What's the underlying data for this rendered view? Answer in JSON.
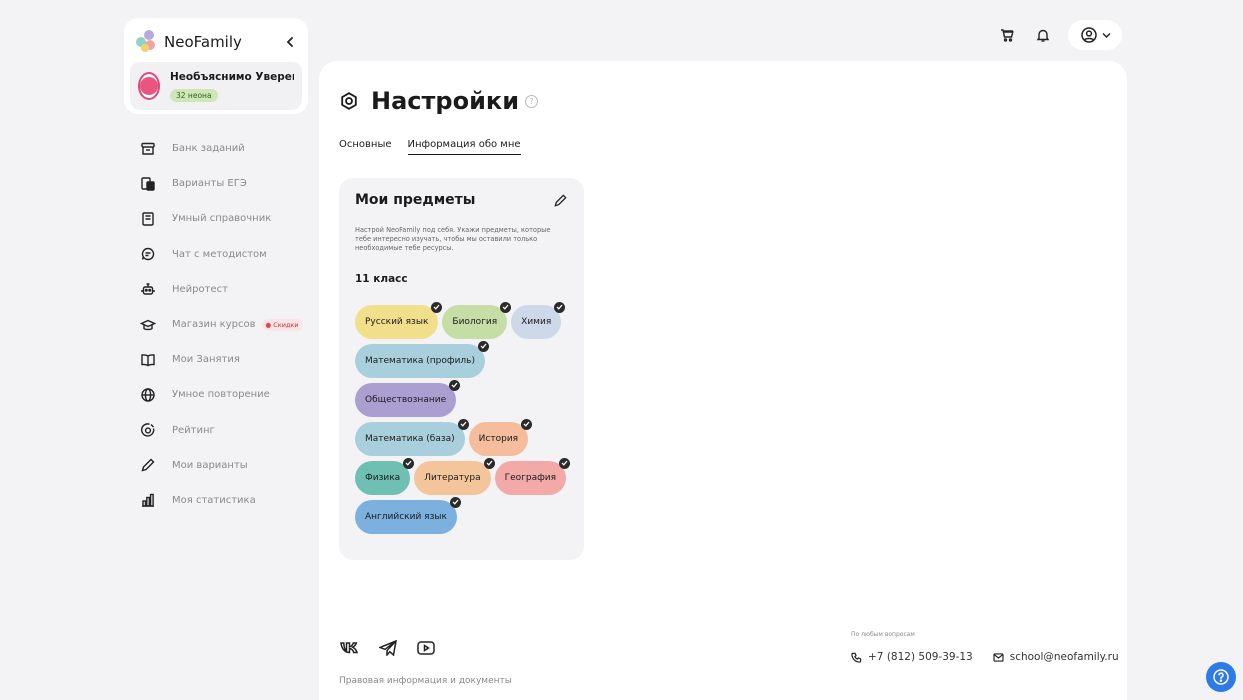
{
  "brand": {
    "name": "NeoFamily",
    "collapse_icon": "chevron-left-icon"
  },
  "user": {
    "name": "Необъяснимо Уверенн...",
    "neons": "32 неона"
  },
  "nav": [
    {
      "label": "Банк заданий",
      "icon": "archive-icon"
    },
    {
      "label": "Варианты ЕГЭ",
      "icon": "documents-icon"
    },
    {
      "label": "Умный справочник",
      "icon": "book-icon"
    },
    {
      "label": "Чат с методистом",
      "icon": "chat-icon"
    },
    {
      "label": "Нейротест",
      "icon": "robot-icon"
    },
    {
      "label": "Магазин курсов",
      "icon": "graduation-cap-icon",
      "badge": "Скидки"
    },
    {
      "label": "Мои Занятия",
      "icon": "open-book-icon"
    },
    {
      "label": "Умное повторение",
      "icon": "globe-icon"
    },
    {
      "label": "Рейтинг",
      "icon": "target-icon"
    },
    {
      "label": "Мои варианты",
      "icon": "pencil-icon"
    },
    {
      "label": "Моя статистика",
      "icon": "bar-chart-icon"
    }
  ],
  "header": {
    "icons": [
      "cart-icon",
      "bell-icon",
      "user-circle-icon"
    ]
  },
  "page": {
    "title": "Настройки",
    "tabs": [
      {
        "label": "Основные",
        "active": false
      },
      {
        "label": "Информация обо мне",
        "active": true
      }
    ]
  },
  "subjects_card": {
    "title": "Мои предметы",
    "description": "Настрой NeoFamily под себя. Укажи предметы, которые тебе интересно изучать, чтобы мы оставили только необходимые тебе ресурсы.",
    "grade": "11 класс",
    "subjects": [
      {
        "label": "Русский язык",
        "color": "#f2df8c",
        "selected": true
      },
      {
        "label": "Биология",
        "color": "#c6dea5",
        "selected": true
      },
      {
        "label": "Химия",
        "color": "#cdd9e8",
        "selected": true
      },
      {
        "label": "Математика (профиль)",
        "color": "#a9cfdc",
        "selected": true
      },
      {
        "label": "Обществознание",
        "color": "#ab9fd1",
        "selected": true
      },
      {
        "label": "Математика (база)",
        "color": "#a9cfdc",
        "selected": true
      },
      {
        "label": "История",
        "color": "#f6bd9c",
        "selected": true
      },
      {
        "label": "Физика",
        "color": "#6fbfb3",
        "selected": true
      },
      {
        "label": "Литература",
        "color": "#f4c49a",
        "selected": true
      },
      {
        "label": "География",
        "color": "#f2a9a8",
        "selected": true
      },
      {
        "label": "Английский язык",
        "color": "#7cb1df",
        "selected": true
      }
    ]
  },
  "footer": {
    "social": [
      "vk-icon",
      "telegram-icon",
      "youtube-icon"
    ],
    "legal": "Правовая информация и документы",
    "contact_label": "По любым вопросам",
    "phone": "+7 (812) 509-39-13",
    "email": "school@neofamily.ru"
  },
  "colors": {
    "accent": "#2e7ae6",
    "background": "#f3f3f5"
  }
}
